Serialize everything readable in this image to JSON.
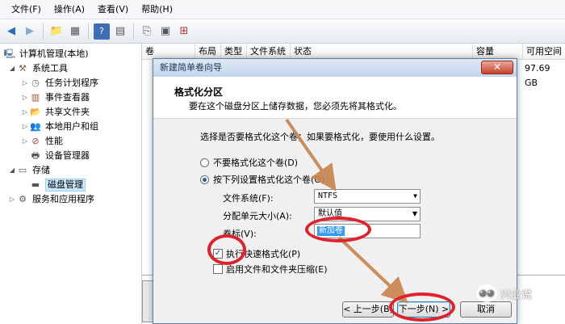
{
  "menubar": {
    "items": [
      "文件(F)",
      "操作(A)",
      "查看(V)",
      "帮助(H)"
    ]
  },
  "toolbar": {
    "icons": [
      "back-arrow-icon",
      "forward-arrow-icon",
      "up-folder-icon",
      "show-tree-icon",
      "help-icon",
      "properties-icon",
      "export-icon",
      "disk-icon"
    ]
  },
  "tree": {
    "root": "计算机管理(本地)",
    "system_tools": "系统工具",
    "task_scheduler": "任务计划程序",
    "event_viewer": "事件查看器",
    "shared_folders": "共享文件夹",
    "local_users": "本地用户和组",
    "performance": "性能",
    "device_manager": "设备管理器",
    "storage": "存储",
    "disk_management": "磁盘管理",
    "services": "服务和应用程序"
  },
  "columns": {
    "volume": "卷",
    "layout": "布局",
    "type": "类型",
    "fs": "文件系统",
    "status": "状态",
    "capacity": "容量",
    "free": "可用空间"
  },
  "row1": {
    "free": "97.69 GB"
  },
  "dialog": {
    "title": "新建简单卷向导",
    "close": "✕",
    "head_title": "格式化分区",
    "head_sub": "要在这个磁盘分区上储存数据，您必须先将其格式化。",
    "prompt": "选择是否要格式化这个卷；如果要格式化，要使用什么设置。",
    "radio_no": "不要格式化这个卷(D)",
    "radio_yes": "按下列设置格式化这个卷(O):",
    "fs_label": "文件系统(F):",
    "fs_value": "NTFS",
    "alloc_label": "分配单元大小(A):",
    "alloc_value": "默认值",
    "vol_label": "卷标(V):",
    "vol_value": "新加卷",
    "quick_format": "执行快速格式化(P)",
    "compress": "启用文件和文件夹压缩(E)",
    "back": "< 上一步(B)",
    "next": "下一步(N) >",
    "cancel": "取消"
  },
  "watermark": {
    "text": "兴业说"
  },
  "colors": {
    "annotation": "#e0222d",
    "arrow": "#c9834c"
  }
}
